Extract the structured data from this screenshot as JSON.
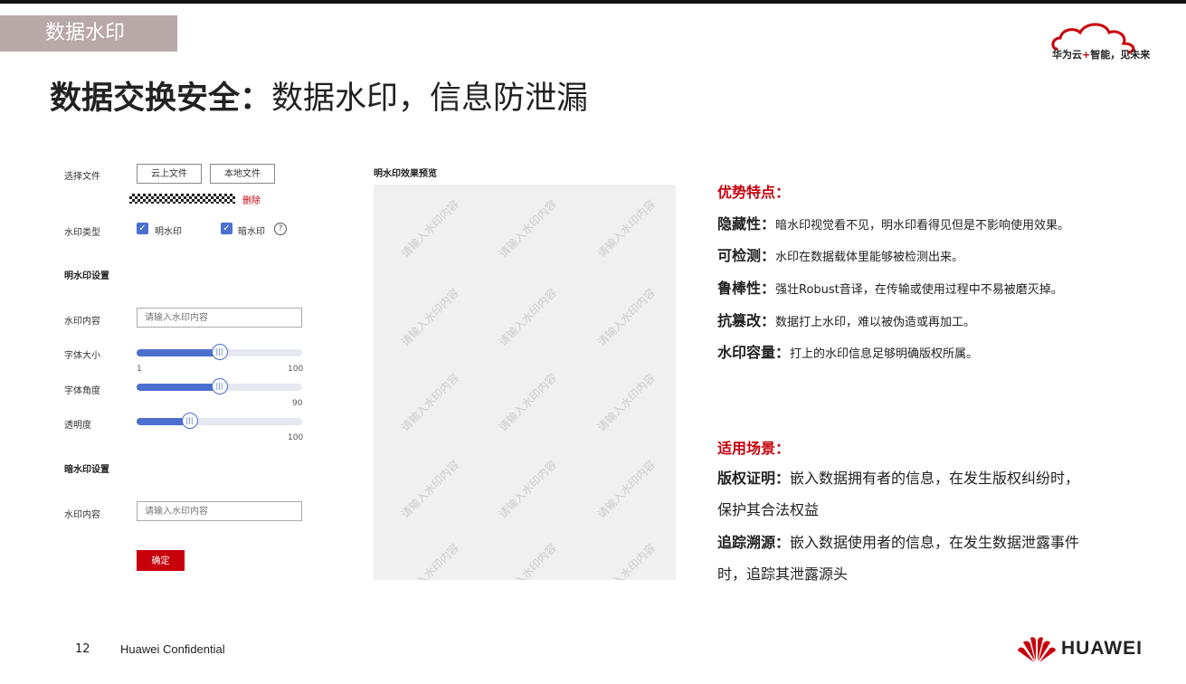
{
  "section_tag": "数据水印",
  "brand": {
    "cloud_text_a": "华为云",
    "cloud_plus": "+",
    "cloud_text_b": "智能，见未来",
    "huawei": "HUAWEI"
  },
  "title": {
    "bold": "数据交换安全：",
    "rest": "数据水印，信息防泄漏"
  },
  "form": {
    "select_file_label": "选择文件",
    "cloud_file_btn": "云上文件",
    "local_file_btn": "本地文件",
    "delete_label": "删除",
    "wm_type_label": "水印类型",
    "visible_wm": "明水印",
    "invisible_wm": "暗水印",
    "visible_settings": "明水印设置",
    "wm_content_label": "水印内容",
    "wm_placeholder": "请输入水印内容",
    "font_size_label": "字体大小",
    "font_size_min": "1",
    "font_size_max": "100",
    "font_size_value": 0.5,
    "font_angle_label": "字体角度",
    "font_angle_max": "90",
    "font_angle_value": 0.5,
    "opacity_label": "透明度",
    "opacity_max": "100",
    "opacity_value": 0.32,
    "invisible_settings": "暗水印设置",
    "wm_content_label2": "水印内容",
    "wm_placeholder2": "请输入水印内容",
    "confirm_btn": "确定"
  },
  "preview": {
    "title": "明水印效果预览",
    "watermark_text": "请输入水印内容"
  },
  "advantages": {
    "heading": "优势特点：",
    "items": [
      {
        "term": "隐藏性：",
        "desc": "暗水印视觉看不见，明水印看得见但是不影响使用效果。"
      },
      {
        "term": "可检测：",
        "desc": "水印在数据载体里能够被检测出来。"
      },
      {
        "term": "鲁棒性：",
        "desc": "强壮Robust音译，在传输或使用过程中不易被磨灭掉。"
      },
      {
        "term": "抗篡改：",
        "desc": "数据打上水印，难以被伪造或再加工。"
      },
      {
        "term": "水印容量：",
        "desc": "打上的水印信息足够明确版权所属。"
      }
    ]
  },
  "scenarios": {
    "heading": "适用场景：",
    "copyright_term": "版权证明：",
    "copyright_line1": "嵌入数据拥有者的信息，在发生版权纠纷时，",
    "copyright_line2": "保护其合法权益",
    "trace_term": "追踪溯源：",
    "trace_line1": "嵌入数据使用者的信息，在发生数据泄露事件",
    "trace_line2": "时，追踪其泄露源头"
  },
  "footer": {
    "page": "12",
    "confidential": "Huawei Confidential"
  }
}
